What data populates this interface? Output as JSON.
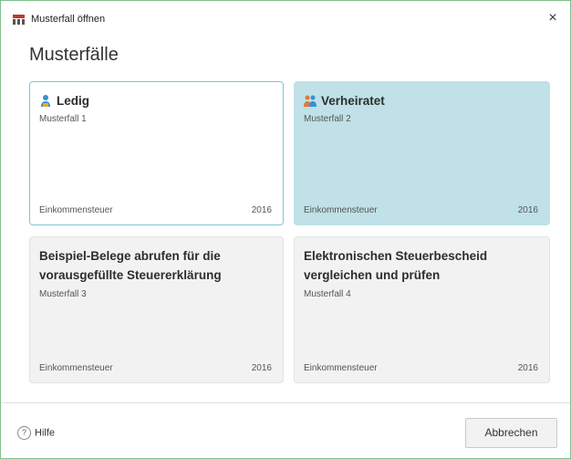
{
  "window": {
    "title": "Musterfall öffnen",
    "close_label": "×"
  },
  "heading": "Musterfälle",
  "cards": [
    {
      "title": "Ledig",
      "subtitle": "Musterfall 1",
      "category": "Einkommensteuer",
      "year": "2016"
    },
    {
      "title": "Verheiratet",
      "subtitle": "Musterfall 2",
      "category": "Einkommensteuer",
      "year": "2016"
    },
    {
      "title": "Beispiel-Belege abrufen für die vorausgefüllte Steuererklärung",
      "subtitle": "Musterfall 3",
      "category": "Einkommensteuer",
      "year": "2016"
    },
    {
      "title": "Elektronischen Steuerbescheid vergleichen und prüfen",
      "subtitle": "Musterfall 4",
      "category": "Einkommensteuer",
      "year": "2016"
    }
  ],
  "footer": {
    "help_icon": "?",
    "help_label": "Hilfe",
    "cancel_label": "Abbrechen"
  },
  "colors": {
    "selected_border": "#7cc8d8",
    "highlight_bg": "#bfe1e7",
    "card_bg": "#f2f2f2"
  }
}
